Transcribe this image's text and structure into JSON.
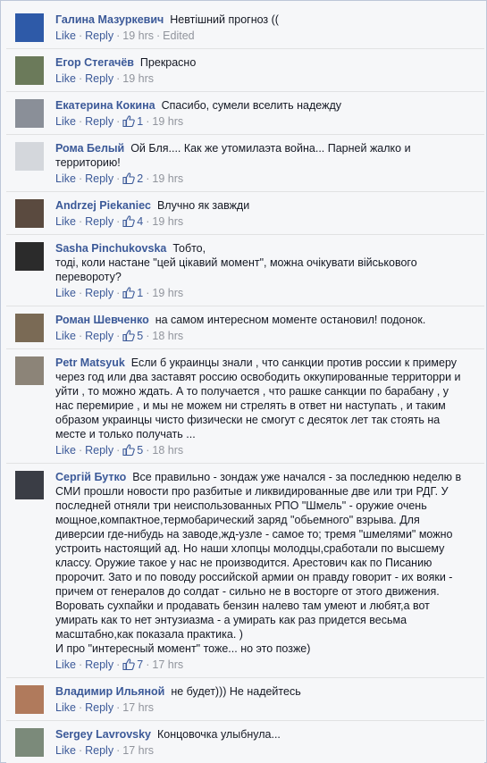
{
  "like_label": "Like",
  "reply_label": "Reply",
  "comments": [
    {
      "author": "Галина Мазуркевич",
      "text": "Невтішний прогноз ((",
      "likes": "",
      "time": "19 hrs",
      "edited": "Edited",
      "avatar_color": "#2e5aa8"
    },
    {
      "author": "Егор Стегачёв",
      "text": "Прекрасно",
      "likes": "",
      "time": "19 hrs",
      "edited": "",
      "avatar_color": "#6b7a5a"
    },
    {
      "author": "Екатерина Кокина",
      "text": "Спасибо, сумели вселить надежду",
      "likes": "1",
      "time": "19 hrs",
      "edited": "",
      "avatar_color": "#8a8f98"
    },
    {
      "author": "Рома Белый",
      "text": "Ой Бля.... Как же утомилаэта война... Парней жалко и территорию!",
      "likes": "2",
      "time": "19 hrs",
      "edited": "",
      "avatar_color": "#d4d7dc"
    },
    {
      "author": "Andrzej Piekaniec",
      "text": "Влучно як завжди",
      "likes": "4",
      "time": "19 hrs",
      "edited": "",
      "avatar_color": "#5a4a3f"
    },
    {
      "author": "Sasha Pinchukovska",
      "text": "Тобто,\nтоді, коли настане \"цей цікавий момент\", можна очікувати військового перевороту?",
      "likes": "1",
      "time": "19 hrs",
      "edited": "",
      "avatar_color": "#2b2b2b"
    },
    {
      "author": "Роман Шевченко",
      "text": "на самом интересном моменте остановил! подонок.",
      "likes": "5",
      "time": "18 hrs",
      "edited": "",
      "avatar_color": "#7a6a55"
    },
    {
      "author": "Petr Matsyuk",
      "text": "Если б украинцы знали , что санкции против россии к примеру через год или два заставят россию освободить оккупированные территорри и уйти , то можно ждать. А то получается , что рашке санкции по барабану , у нас перемирие , и мы не можем ни стрелять в ответ ни наступать , и таким образом украинцы чисто физически не смогут с десяток лет так стоять на месте и только получать ...",
      "likes": "5",
      "time": "18 hrs",
      "edited": "",
      "avatar_color": "#8c8478"
    },
    {
      "author": "Сергій Бутко",
      "text": "Все правильно - зондаж уже начался - за последнюю неделю в СМИ прошли новости про разбитые и ликвидированные две или три РДГ. У последней отняли три неиспользованных РПО \"Шмель\" - оружие очень мощное,компактное,термобарический заряд \"обьемного\" взрыва. Для диверсии где-нибудь на заводе,жд-узле - самое то; тремя \"шмелями\" можно устроить настоящий ад. Но наши хлопцы молодцы,сработали по высшему классу. Оружие такое у нас не производится. Арестович как по Писанию пророчит. Зато и по поводу российской армии он правду говорит - их вояки - причем от генералов до солдат - сильно не в восторге от этого движения. Воровать сухпайки и продавать бензин налево там умеют и любят,а вот умирать как то нет энтузиазма - а умирать как раз придется весьма масштабно,как показала практика. )\nИ про \"интересный момент\" тоже... но это позже)",
      "likes": "7",
      "time": "17 hrs",
      "edited": "",
      "avatar_color": "#3a3d45"
    },
    {
      "author": "Владимир Ильяной",
      "text": "не будет))) Не надейтесь",
      "likes": "",
      "time": "17 hrs",
      "edited": "",
      "avatar_color": "#b07a5c"
    },
    {
      "author": "Sergey Lavrovsky",
      "text": "Концовочка улыбнула...",
      "likes": "",
      "time": "17 hrs",
      "edited": "",
      "avatar_color": "#7b8a7a"
    }
  ]
}
